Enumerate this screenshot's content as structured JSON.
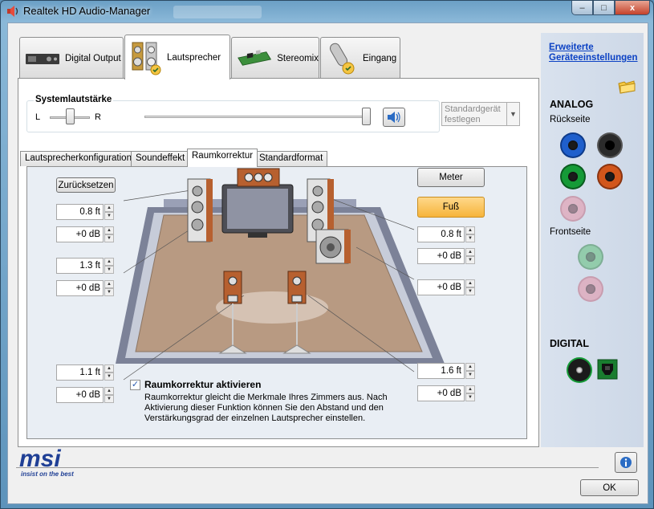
{
  "window": {
    "title": "Realtek HD Audio-Manager",
    "controls": {
      "minimize": "–",
      "maximize": "□",
      "close": "x"
    }
  },
  "device_tabs": [
    {
      "label": "Digital Output",
      "icon": "digital-output-device-icon",
      "active": false
    },
    {
      "label": "Lautsprecher",
      "icon": "speakers-icon",
      "active": true
    },
    {
      "label": "Stereomix",
      "icon": "sound-card-icon",
      "active": false
    },
    {
      "label": "Eingang",
      "icon": "microphone-icon",
      "active": false
    }
  ],
  "system_volume": {
    "title": "Systemlautstärke",
    "left_label": "L",
    "right_label": "R",
    "balance": 0.5,
    "level": 0.98,
    "mute_icon": "speaker-volume-icon"
  },
  "default_device": {
    "label": "Standardgerät festlegen"
  },
  "sub_tabs": [
    {
      "label": "Lautsprecherkonfiguration",
      "active": false
    },
    {
      "label": "Soundeffekt",
      "active": false
    },
    {
      "label": "Raumkorrektur",
      "active": true
    },
    {
      "label": "Standardformat",
      "active": false
    }
  ],
  "room_correction": {
    "reset_label": "Zurücksetzen",
    "meter_label": "Meter",
    "feet_label": "Fuß",
    "unit_active": "Fuß",
    "left_front": {
      "distance": "0.8 ft",
      "gain": "+0 dB"
    },
    "left_center": {
      "distance": "1.3 ft",
      "gain": "+0 dB"
    },
    "left_rear": {
      "distance": "1.1 ft",
      "gain": "+0 dB"
    },
    "right_front": {
      "distance": "0.8 ft",
      "gain": "+0 dB"
    },
    "subwoofer": {
      "gain": "+0 dB"
    },
    "right_rear": {
      "distance": "1.6 ft",
      "gain": "+0 dB"
    },
    "enable_checkbox": {
      "checked": true,
      "label": "Raumkorrektur aktivieren",
      "description": "Raumkorrektur gleicht die Merkmale Ihres Zimmers aus. Nach Aktivierung dieser Funktion können Sie den Abstand und den Verstärkungsgrad der einzelnen Lautsprecher einstellen."
    },
    "colors": {
      "floor": "#b89a82",
      "floor_edge": "#8c7563",
      "wall": "#a7acbf",
      "accent_button": "#f6b43b"
    }
  },
  "right_panel": {
    "advanced_link": "Erweiterte Geräteeinstellungen",
    "analog_title": "ANALOG",
    "rear_label": "Rückseite",
    "front_label": "Frontseite",
    "digital_title": "DIGITAL",
    "rear_jacks": [
      {
        "name": "blue-jack",
        "color": "#1f5fcc",
        "faded": false
      },
      {
        "name": "black-jack",
        "color": "#2b2b2b",
        "faded": false
      },
      {
        "name": "green-jack",
        "color": "#159a37",
        "faded": false
      },
      {
        "name": "orange-jack",
        "color": "#d2561b",
        "faded": false
      },
      {
        "name": "pink-jack",
        "color": "#e591a6",
        "faded": true
      }
    ],
    "front_jacks": [
      {
        "name": "green-jack",
        "color": "#5fbf79",
        "faded": true
      },
      {
        "name": "pink-jack",
        "color": "#e591a6",
        "faded": true
      }
    ]
  },
  "footer": {
    "brand": "msi",
    "tagline": "insist on the best",
    "ok_label": "OK",
    "info_icon": "info-icon"
  }
}
